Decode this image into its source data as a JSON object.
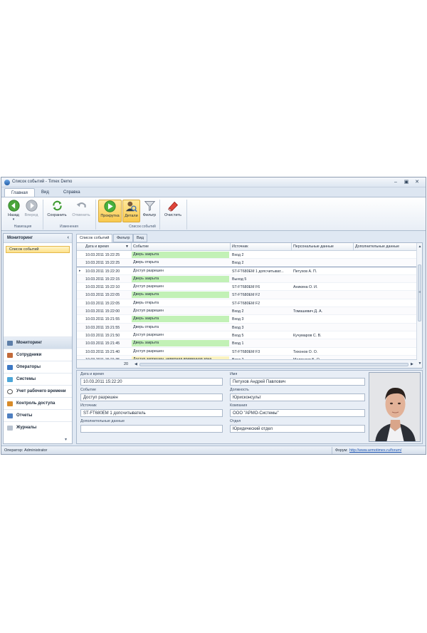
{
  "window": {
    "title": "Список событий - Timex Demo"
  },
  "ribbon_tabs": [
    "Главная",
    "Вид",
    "Справка"
  ],
  "ribbon": {
    "back": "Назад",
    "forward": "Вперед",
    "save": "Сохранить",
    "cancel": "Отменить",
    "scroll": "Прокрутка",
    "details": "Детали",
    "filter": "Фильтр",
    "clear": "Очистить",
    "groups": [
      "Навигация",
      "Изменения",
      "Список событий"
    ]
  },
  "nav": {
    "header": "Мониторинг",
    "selected_item": "Список событий",
    "groups": [
      "Мониторинг",
      "Сотрудники",
      "Операторы",
      "Системы",
      "Учет рабочего времени",
      "Контроль доступа",
      "Отчеты",
      "Журналы"
    ]
  },
  "content_tabs": [
    "Список событий",
    "Фильтр",
    "Вид"
  ],
  "grid": {
    "columns": [
      "Дата и время",
      "Событие",
      "Источник",
      "Персональные данные",
      "Дополнительные данные"
    ],
    "rows": [
      {
        "dt": "10.03.2011 15:22:25",
        "event": "Дверь закрыта",
        "color": "green",
        "source": "Вход 2",
        "person": "",
        "extra": ""
      },
      {
        "dt": "10.03.2011 15:22:25",
        "event": "Дверь открыта",
        "color": "",
        "source": "Вход 2",
        "person": "",
        "extra": ""
      },
      {
        "dt": "10.03.2011 15:22:20",
        "event": "Доступ разрешен",
        "color": "",
        "source": "ST-FT680EM 1 допсчитыват...",
        "person": "Петухов А. П.",
        "extra": ""
      },
      {
        "dt": "10.03.2011 15:22:15",
        "event": "Дверь закрыта",
        "color": "green",
        "source": "Выход 5",
        "person": "",
        "extra": ""
      },
      {
        "dt": "10.03.2011 15:22:10",
        "event": "Доступ разрешен",
        "color": "",
        "source": "ST-FT680EM F6",
        "person": "Аникина О. И.",
        "extra": ""
      },
      {
        "dt": "10.03.2011 15:22:05",
        "event": "Дверь закрыта",
        "color": "green",
        "source": "ST-FT680EM F2",
        "person": "",
        "extra": ""
      },
      {
        "dt": "10.03.2011 15:22:05",
        "event": "Дверь открыта",
        "color": "",
        "source": "ST-FT680EM F2",
        "person": "",
        "extra": ""
      },
      {
        "dt": "10.03.2011 15:22:00",
        "event": "Доступ разрешен",
        "color": "",
        "source": "Вход 2",
        "person": "Томашевич Д. А.",
        "extra": ""
      },
      {
        "dt": "10.03.2011 15:21:55",
        "event": "Дверь закрыта",
        "color": "green",
        "source": "Вход 3",
        "person": "",
        "extra": ""
      },
      {
        "dt": "10.03.2011 15:21:55",
        "event": "Дверь открыта",
        "color": "",
        "source": "Вход 3",
        "person": "",
        "extra": ""
      },
      {
        "dt": "10.03.2011 15:21:50",
        "event": "Доступ разрешен",
        "color": "",
        "source": "Вход 5",
        "person": "Кучумаров С. В.",
        "extra": ""
      },
      {
        "dt": "10.03.2011 15:21:45",
        "event": "Дверь закрыта",
        "color": "green",
        "source": "Вход 1",
        "person": "",
        "extra": ""
      },
      {
        "dt": "10.03.2011 15:21:40",
        "event": "Доступ разрешен",
        "color": "",
        "source": "ST-FT680EM F3",
        "person": "Тихонов О. О.",
        "extra": ""
      },
      {
        "dt": "10.03.2011 15:21:35",
        "event": "Доступ запрещен, неверная временная зона",
        "color": "yellow",
        "source": "Вход 2",
        "person": "Медведев Б. О.",
        "extra": ""
      }
    ],
    "row_count": "20"
  },
  "detail": {
    "datetime_label": "Дата и время",
    "datetime_value": "10.03.2011 15:22:20",
    "event_label": "Событие",
    "event_value": "Доступ разрешен",
    "source_label": "Источник",
    "source_value": "ST-FT680EM 1 допсчитыватель",
    "extra_label": "Дополнительные данные",
    "extra_value": "",
    "name_label": "Имя",
    "name_value": "Петухов Андрей Павлович",
    "position_label": "Должность",
    "position_value": "Юрисконсульт",
    "company_label": "Компания",
    "company_value": "ООО \"АРМО-Системы\"",
    "dept_label": "Отдел",
    "dept_value": "Юридический отдел"
  },
  "status": {
    "operator": "Оператор: Administrator",
    "forum_label": "Форум:",
    "forum_link": "http://www.armotimex.ru/forum/"
  },
  "colors": {
    "event_green": "#c2f1b6",
    "event_yellow": "#fbf3bf",
    "selection": "#fde18a"
  }
}
